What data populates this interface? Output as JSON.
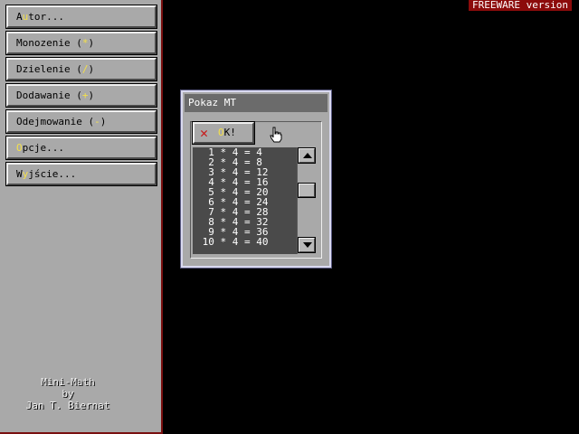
{
  "badge": {
    "freeware": "FREEWARE version"
  },
  "menu": {
    "items": [
      {
        "pre": "A",
        "hotkey": "u",
        "post": "tor..."
      },
      {
        "pre": "Monozenie (",
        "hotkey": "*",
        "post": ")"
      },
      {
        "pre": "Dzielenie (",
        "hotkey": "/",
        "post": ")"
      },
      {
        "pre": "Dodawanie (",
        "hotkey": "+",
        "post": ")"
      },
      {
        "pre": "Odejmowanie (",
        "hotkey": "-",
        "post": ")"
      },
      {
        "pre": "",
        "hotkey": "O",
        "post": "pcje..."
      },
      {
        "pre": "W",
        "hotkey": "y",
        "post": "jście..."
      }
    ]
  },
  "credits": {
    "line1": "Mini-Math",
    "line2": "by",
    "line3": "Jan T. Biernat"
  },
  "dialog": {
    "title": "Pokaz MT",
    "ok": {
      "hotkey": "O",
      "post": "K!"
    },
    "rows": [
      "1 * 4 = 4",
      "2 * 4 = 8",
      "3 * 4 = 12",
      "4 * 4 = 16",
      "5 * 4 = 20",
      "6 * 4 = 24",
      "7 * 4 = 28",
      "8 * 4 = 32",
      "9 * 4 = 36",
      "10 * 4 = 40"
    ]
  },
  "colors": {
    "hotkey": "#f4e04a",
    "panel": "#a9a9a9",
    "list_bg": "#4a4a4a",
    "badge_bg": "#8c0b0b",
    "close_x": "#c81818"
  }
}
